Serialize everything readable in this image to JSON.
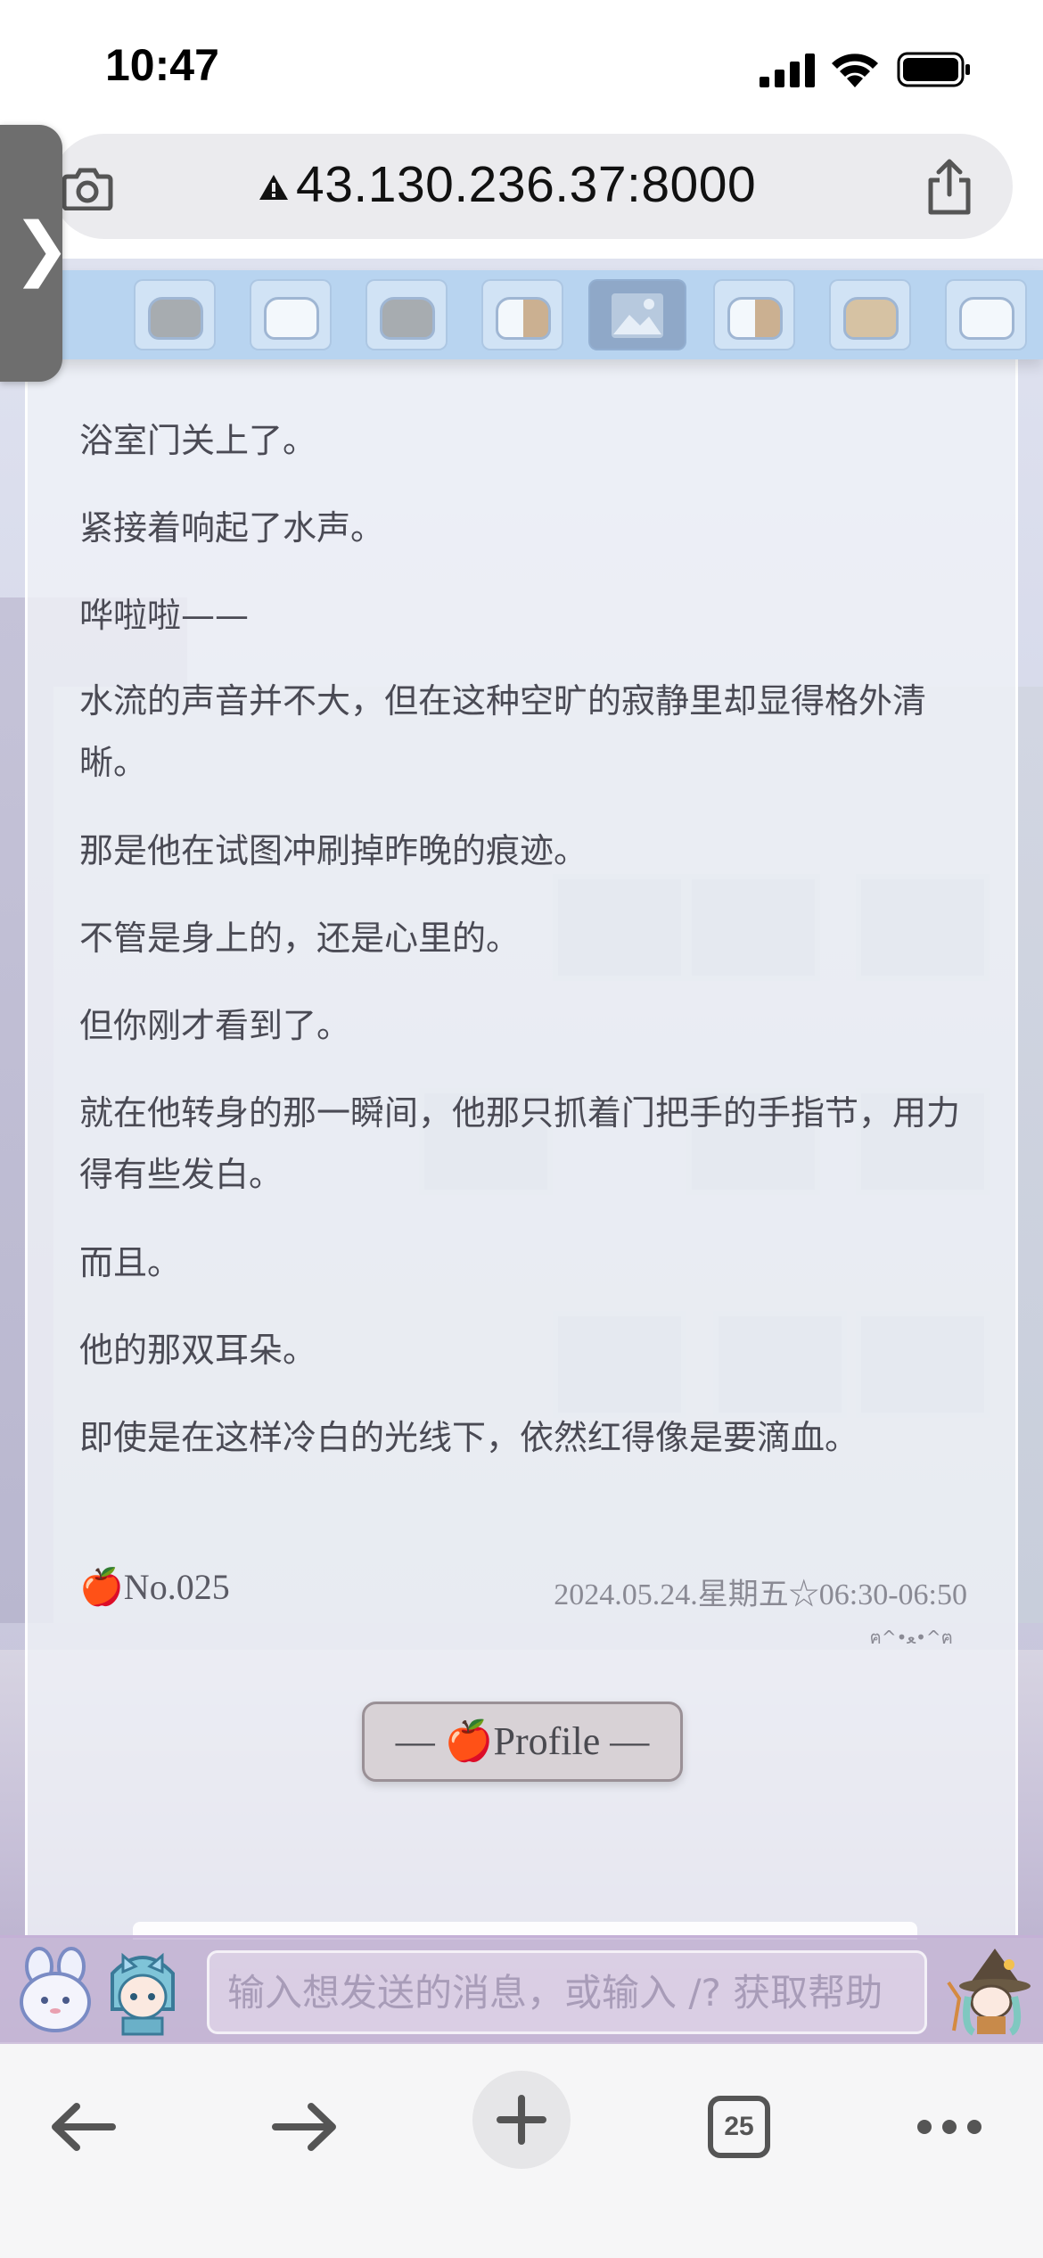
{
  "status_bar": {
    "time": "10:47"
  },
  "url_bar": {
    "url": "43.130.236.37:8000"
  },
  "side_toggle": {
    "glyph": "❯"
  },
  "message": {
    "paragraphs": [
      "浴室门关上了。",
      "紧接着响起了水声。",
      "哗啦啦——",
      "水流的声音并不大，但在这种空旷的寂静里却显得格外清晰。",
      "那是他在试图冲刷掉昨晚的痕迹。",
      "不管是身上的，还是心里的。",
      "但你刚才看到了。",
      "就在他转身的那一瞬间，他那只抓着门把手的手指节，用力得有些发白。",
      "而且。",
      "他的那双耳朵。",
      "即使是在这样冷白的光线下，依然红得像是要滴血。"
    ],
    "number": "🍎No.025",
    "timestamp": "2024.05.24.星期五☆06:30-06:50",
    "kaomoji": "ฅ^•ﻌ•^ฅ",
    "profile_button": "— 🍎Profile —"
  },
  "input": {
    "placeholder": "输入想发送的消息，或输入 /? 获取帮助"
  },
  "toolbar": {
    "tabs_count": "25"
  },
  "colors": {
    "avatar_strip": "#b8d4f0",
    "input_bar": "#c8b9d7",
    "message_text": "#4a4a54"
  },
  "icons": [
    "camera-icon",
    "warning-icon",
    "share-icon",
    "back-arrow-icon",
    "forward-arrow-icon",
    "plus-icon",
    "tabs-icon",
    "more-icon"
  ]
}
